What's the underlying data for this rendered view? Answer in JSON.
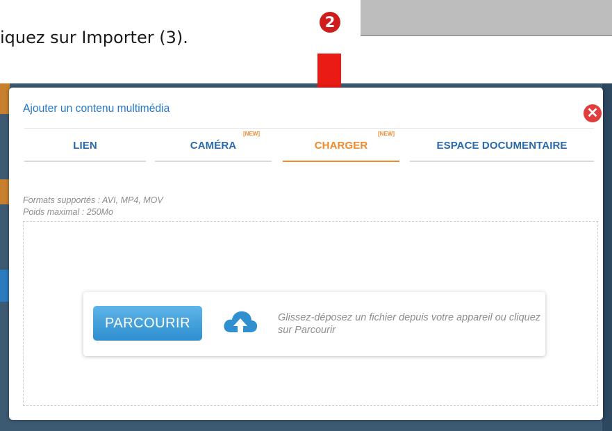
{
  "instruction": {
    "text": "iquez sur Importer (3)."
  },
  "step_marker": {
    "number": "2",
    "color": "#cf1d1d"
  },
  "modal": {
    "title": "Ajouter un contenu multimédia",
    "close_symbol": "✕",
    "tabs": [
      {
        "label": "LIEN",
        "new_badge": "",
        "active": false
      },
      {
        "label": "CAMÉRA",
        "new_badge": "[NEW]",
        "active": false
      },
      {
        "label": "CHARGER",
        "new_badge": "[NEW]",
        "active": true
      },
      {
        "label": "ESPACE DOCUMENTAIRE",
        "new_badge": "",
        "active": false
      }
    ],
    "formats_supported": "Formats supportés : AVI, MP4, MOV",
    "max_weight": "Poids maximal : 250Mo",
    "browse_button": "PARCOURIR",
    "drop_hint": "Glissez-déposez un fichier depuis votre appareil ou cliquez sur Parcourir",
    "icon": "cloud-upload-icon"
  },
  "colors": {
    "accent_orange": "#f28a2b",
    "title_blue": "#2578c9",
    "close_red": "#e13d3d",
    "arrow_red": "#ea1b14"
  }
}
